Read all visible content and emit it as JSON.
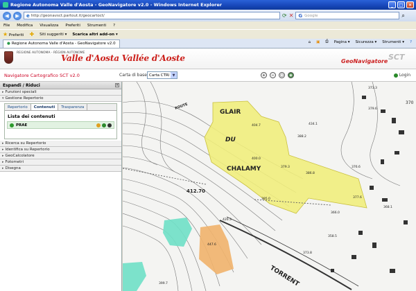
{
  "browser": {
    "title": "Regione Autonoma Valle d'Aosta - GeoNavigatore v2.0 - Windows Internet Explorer",
    "url": "http://geonavsct.partout.it/geocartoct/",
    "search_placeholder": "Google",
    "menu": [
      "File",
      "Modifica",
      "Visualizza",
      "Preferiti",
      "Strumenti",
      "?"
    ],
    "favorites": {
      "label": "Preferiti",
      "items": [
        "Siti suggeriti ▾",
        "Scarica altri add-on ▾"
      ]
    },
    "tab_label": "Regione Autonoma Valle d'Aosta - GeoNavigatore v2.0",
    "tab_tools": [
      "Pagina ▾",
      "Sicurezza ▾",
      "Strumenti ▾"
    ]
  },
  "header": {
    "region_name": "REGIONE AUTONOMA - RÉGION AUTONOME",
    "logo_text": "Valle d'Aosta Vallée d'Aoste",
    "app_name": "GeoNavigatore",
    "watermark": "SCT"
  },
  "toolbar": {
    "nav_title": "Navigatore Cartografico SCT v2.0",
    "carta_label": "Carta di base",
    "carta_value": "Carta CTRl",
    "login": "Login"
  },
  "sidebar": {
    "header": "Espandi / Riduci",
    "sections_top": [
      "Funzioni speciali",
      "Gestione Repertorio"
    ],
    "tabs": [
      "Repertorio",
      "Contenuti",
      "Trasparenza"
    ],
    "active_tab": "Contenuti",
    "list_title": "Lista dei contenuti",
    "list_item": "PRAE",
    "sections_bottom": [
      "Ricerca su Repertorio",
      "Identifica su Repertorio",
      "GeoCalcolatore",
      "Fotometri",
      "Disegna"
    ]
  },
  "map": {
    "labels": [
      "GLAIR",
      "DU",
      "CHALAMY",
      "TORRENT",
      "ROUTE"
    ],
    "elevations": [
      "412.70",
      "404.7",
      "400.0",
      "379.3",
      "376.6",
      "395.0",
      "366.0",
      "447.6",
      "426.3",
      "434.1",
      "373.3",
      "358.5",
      "386.8",
      "373.8",
      "379.6",
      "388.2",
      "399.7",
      "370",
      "368.1",
      "377.6"
    ],
    "colors": {
      "yellow": "#f0ee7a",
      "cyan": "#6fe0c6",
      "orange": "#f1b36c"
    }
  }
}
